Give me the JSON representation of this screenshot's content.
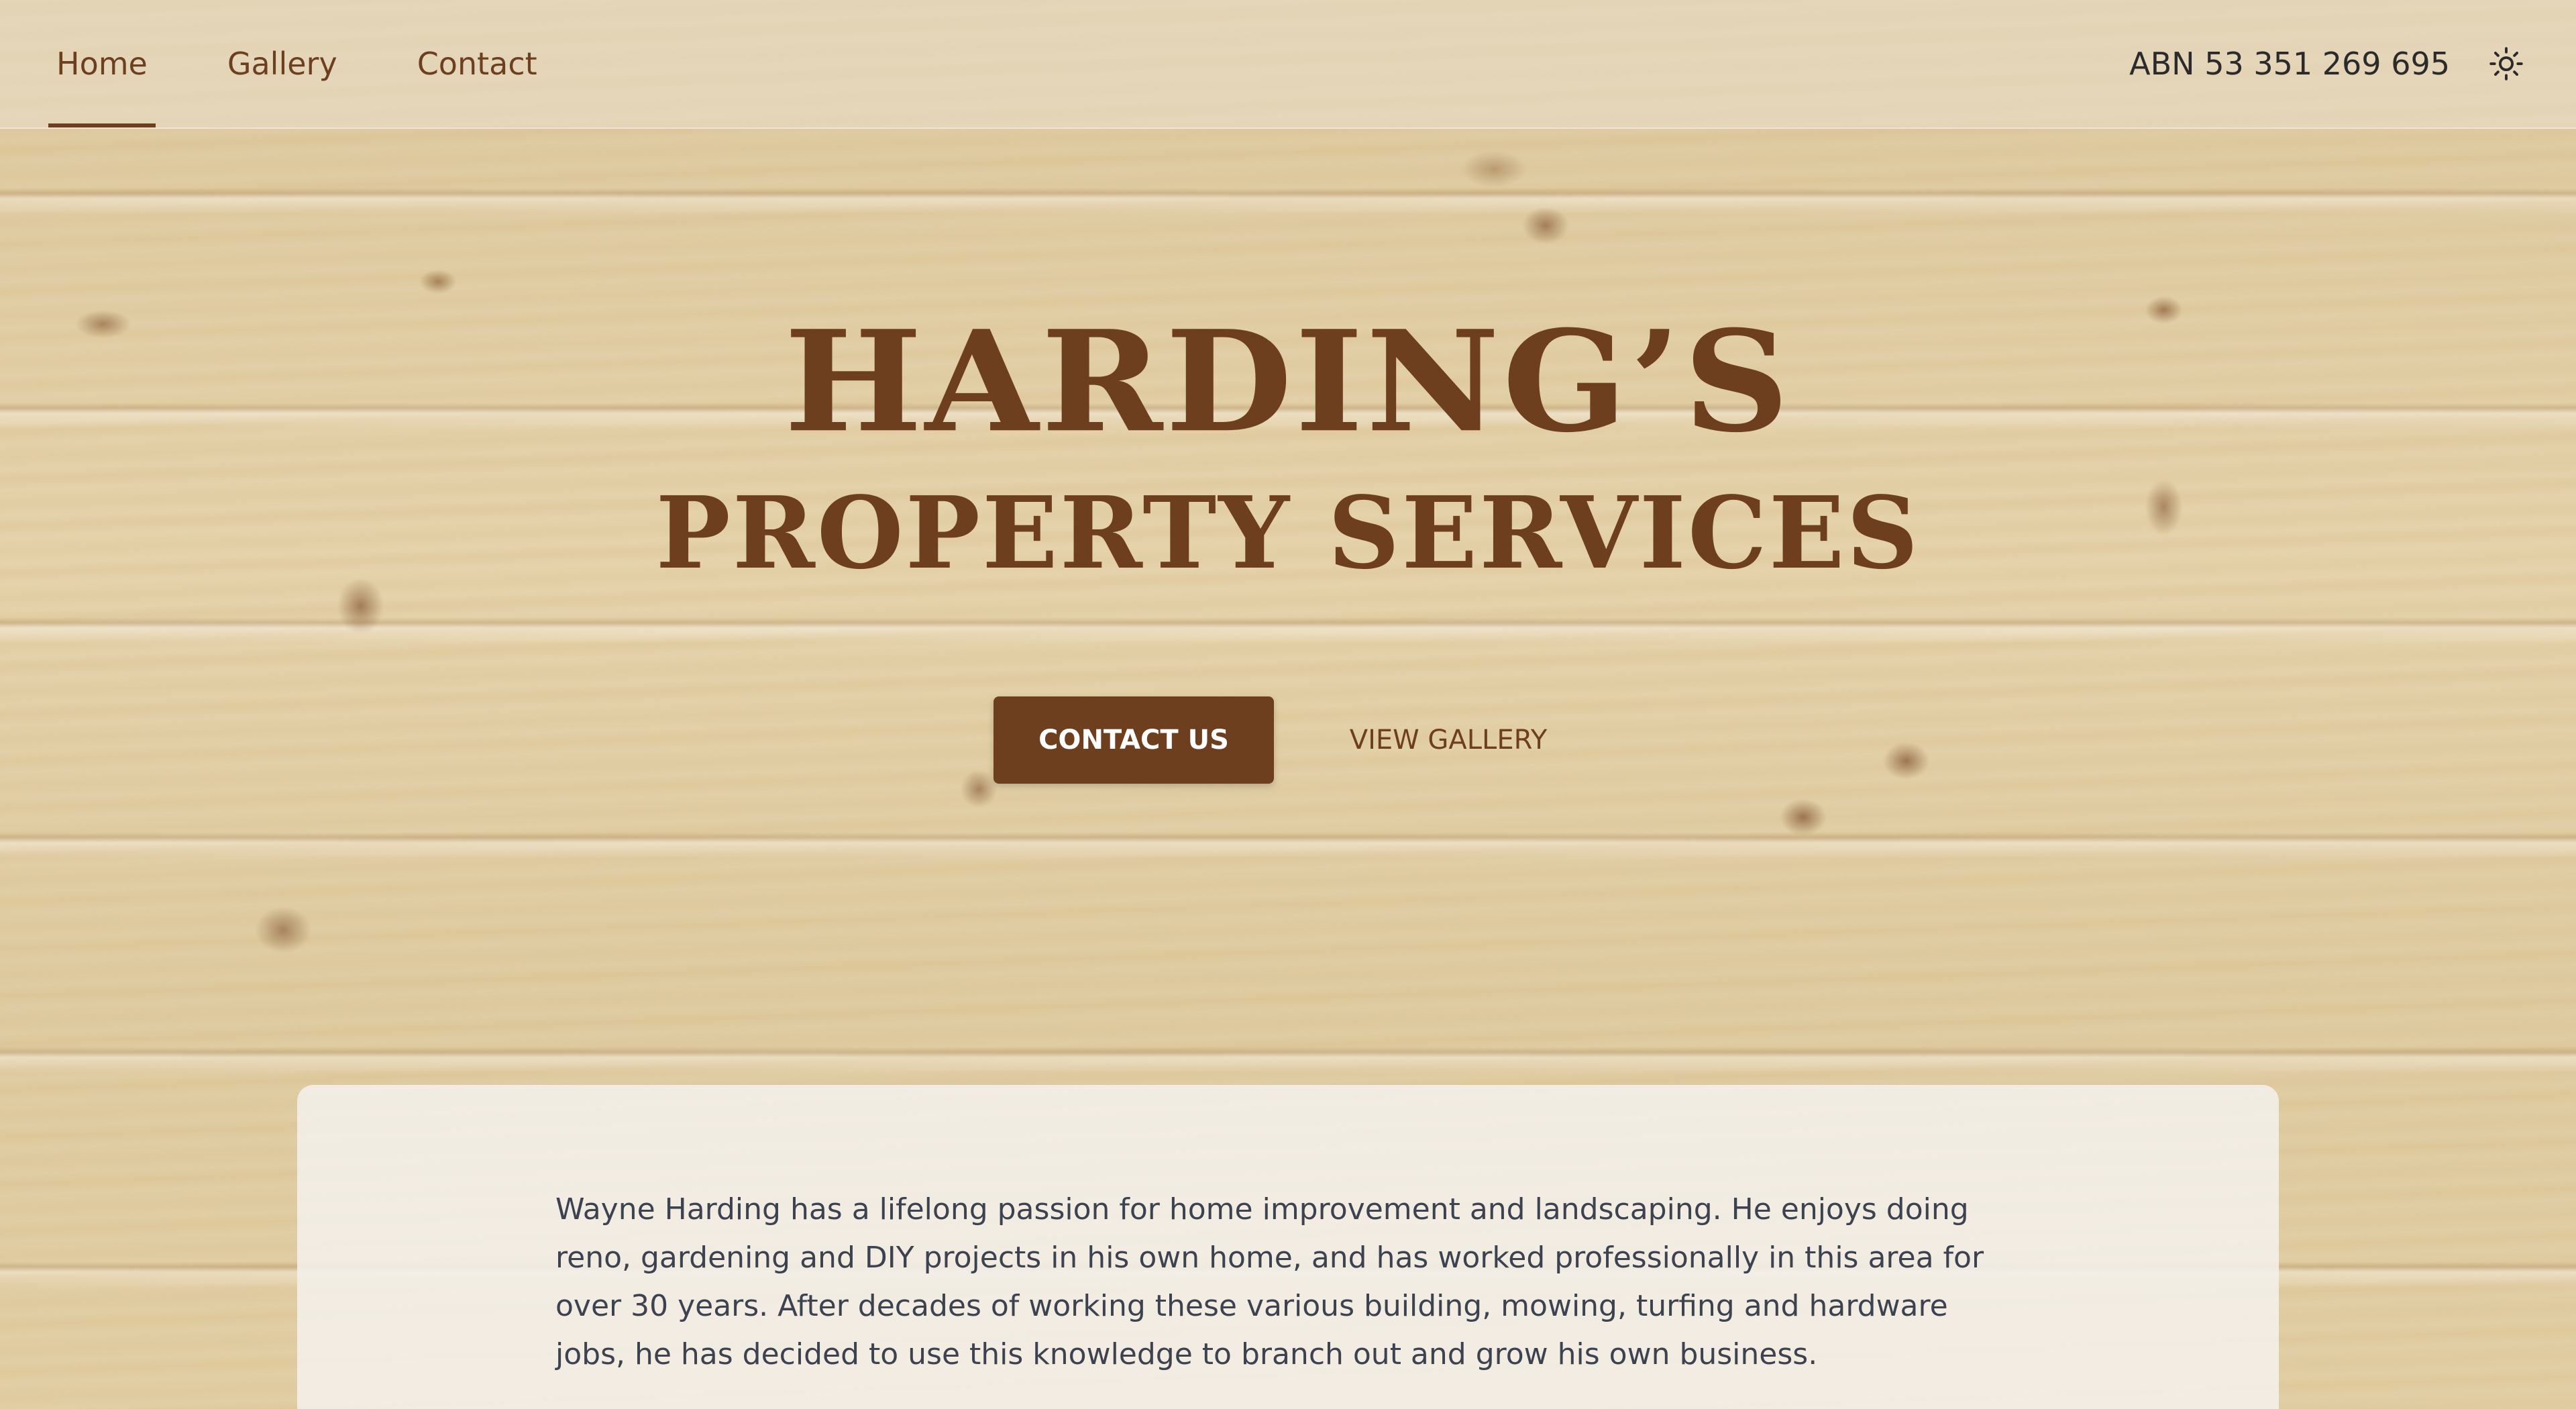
{
  "nav": {
    "links": [
      {
        "label": "Home",
        "active": true
      },
      {
        "label": "Gallery",
        "active": false
      },
      {
        "label": "Contact",
        "active": false
      }
    ],
    "abn": "ABN 53 351 269 695",
    "theme_toggle_icon": "sun-icon"
  },
  "hero": {
    "title": "HARDING’S",
    "subtitle": "PROPERTY SERVICES",
    "primary_button": "CONTACT US",
    "secondary_button": "VIEW GALLERY"
  },
  "about": {
    "text": "Wayne Harding has a lifelong passion for home improvement and landscaping. He enjoys doing reno, gardening and DIY projects in his own home, and has worked professionally in this area for over 30 years. After decades of working these various building, mowing, turfing and hardware jobs, he has decided to use this knowledge to branch out and grow his own business."
  },
  "colors": {
    "brand": "#6e3f1f",
    "text_dark": "#2b2b2b",
    "card_text": "#3c4250"
  }
}
